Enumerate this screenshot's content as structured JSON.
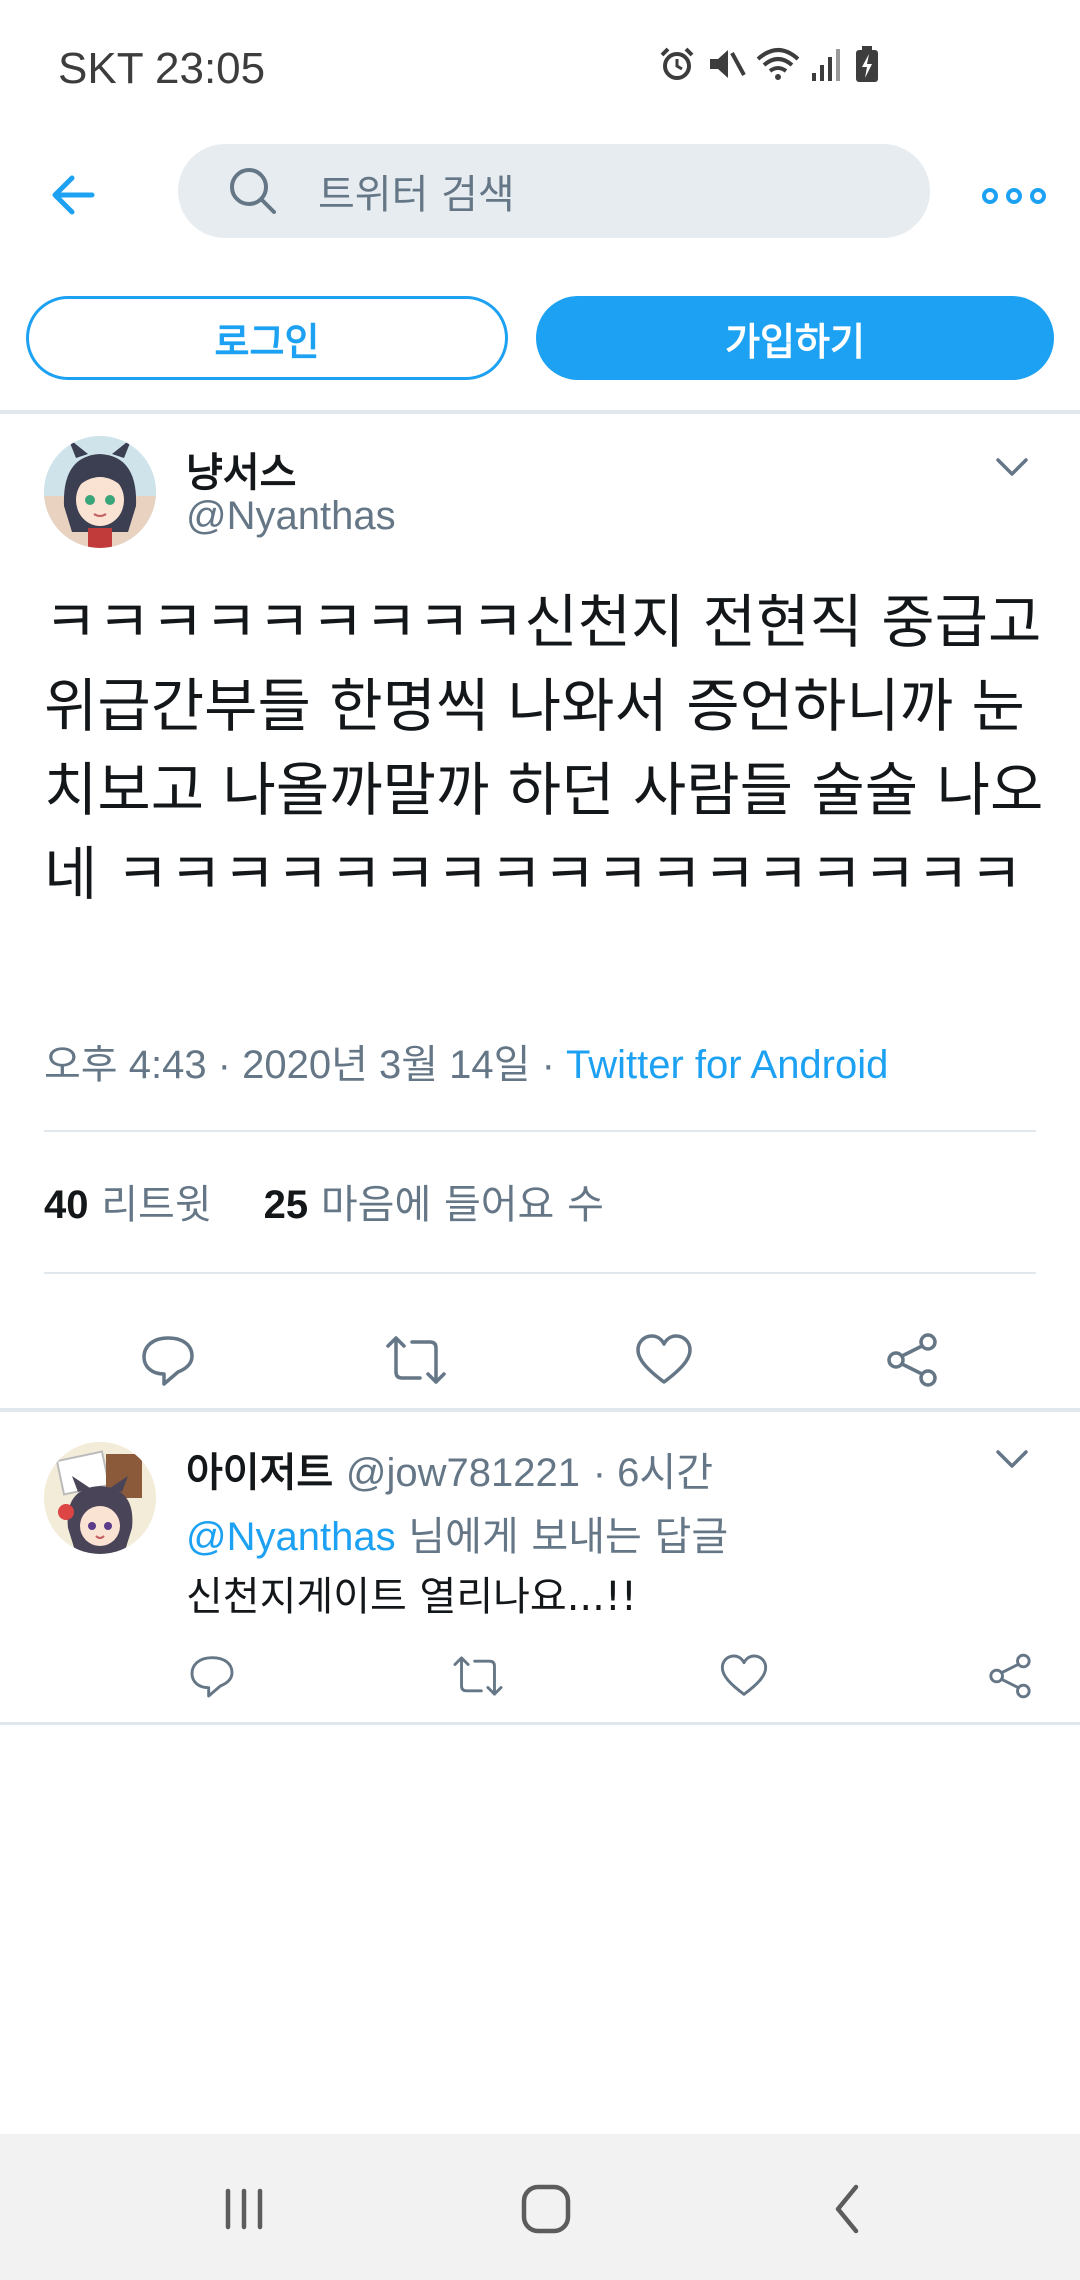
{
  "status_bar": {
    "carrier_time": "SKT 23:05"
  },
  "search": {
    "placeholder": "트위터 검색"
  },
  "auth": {
    "login_label": "로그인",
    "signup_label": "가입하기"
  },
  "tweet": {
    "author_name": "냥서스",
    "author_handle": "@Nyanthas",
    "text": "ㅋㅋㅋㅋㅋㅋㅋㅋㅋ신천지 전현직 중급고위급간부들 한명씩 나와서 증언하니까 눈치보고 나올까말까 하던 사람들 술술 나오네 ㅋㅋㅋㅋㅋㅋㅋㅋㅋㅋㅋㅋㅋㅋㅋㅋㅋ",
    "time": "오후 4:43 · 2020년 3월 14일 · ",
    "source": "Twitter for Android",
    "retweets_count": "40",
    "retweets_label": "리트윗",
    "likes_count": "25",
    "likes_label": "마음에 들어요 수"
  },
  "reply": {
    "author_name": "아이저트",
    "author_handle": "@jow781221",
    "time": "· 6시간",
    "mention": "@Nyanthas",
    "replying_suffix": " 님에게 보내는 답글",
    "text": "신천지게이트 열리나요...!!"
  },
  "colors": {
    "accent": "#1da1f2",
    "secondary_text": "#657786",
    "divider": "#e1e8ed"
  },
  "icons": [
    "back-arrow-icon",
    "search-icon",
    "more-icon",
    "chevron-down-icon",
    "reply-icon",
    "retweet-icon",
    "like-icon",
    "share-icon",
    "recents-icon",
    "home-icon",
    "nav-back-icon"
  ]
}
